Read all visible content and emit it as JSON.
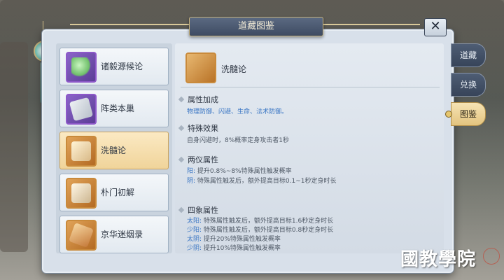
{
  "window": {
    "title": "道藏图鉴",
    "close_label": "✕"
  },
  "list": [
    {
      "label": "诸毅源候论",
      "icon": "jade-ruyi-icon",
      "rarity": "purple"
    },
    {
      "label": "阵类本巢",
      "icon": "scroll-tag-icon",
      "rarity": "purple"
    },
    {
      "label": "洗髓论",
      "icon": "book-icon",
      "rarity": "gold",
      "selected": true
    },
    {
      "label": "朴门初解",
      "icon": "book-icon",
      "rarity": "gold"
    },
    {
      "label": "京华迷烟录",
      "icon": "scroll-icon",
      "rarity": "gold"
    }
  ],
  "detail": {
    "name": "洗髓论",
    "sections": [
      {
        "title": "属性加成",
        "lines": [
          {
            "tag": "",
            "text": "物理防御、闪避、生命、法术防御。",
            "highlight": true
          }
        ]
      },
      {
        "title": "特殊效果",
        "lines": [
          {
            "tag": "",
            "text": "自身闪避时，8%概率定身攻击者1秒"
          }
        ]
      },
      {
        "title": "两仪属性",
        "lines": [
          {
            "tag": "阳:",
            "text": "提升0.8%~8%特殊属性触发概率"
          },
          {
            "tag": "阴:",
            "text": "特殊属性触发后，额外提高目标0.1~1秒定身时长"
          }
        ]
      },
      {
        "title": "四象属性",
        "lines": [
          {
            "tag": "太阳:",
            "text": "特殊属性触发后，额外提高目标1.6秒定身时长"
          },
          {
            "tag": "少阳:",
            "text": "特殊属性触发后，额外提高目标0.8秒定身时长"
          },
          {
            "tag": "太阴:",
            "text": "提升20%特殊属性触发概率"
          },
          {
            "tag": "少阴:",
            "text": "提升10%特殊属性触发概率"
          }
        ]
      }
    ]
  },
  "side_tabs": [
    "道藏",
    "兑换",
    "图鉴"
  ],
  "watermark": "國教學院",
  "colors": {
    "accent_gold": "#e3c47f",
    "tab_dark": "#374459",
    "attr_blue": "#3a76c4",
    "rarity_purple": "#8d58c9",
    "rarity_gold": "#c98a3b"
  }
}
